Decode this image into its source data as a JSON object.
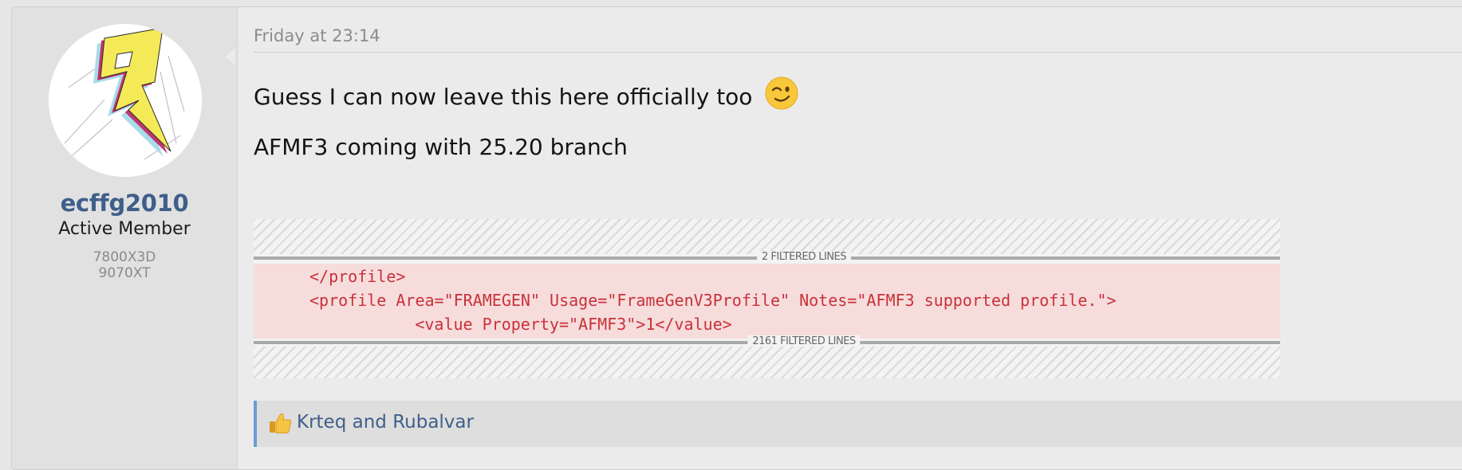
{
  "author": {
    "username": "ecffg2010",
    "title": "Active Member",
    "extras": [
      "7800X3D",
      "9070XT"
    ]
  },
  "post": {
    "date": "Friday at 23:14",
    "lines": [
      "Guess I can now leave this here officially too",
      "AFMF3 coming with 25.20 branch"
    ],
    "emoji": "winking-face-icon"
  },
  "diff": {
    "top_filter": "2 FILTERED LINES",
    "bottom_filter": "2161 FILTERED LINES",
    "code_lines": [
      "</profile>",
      "<profile Area=\"FRAMEGEN\" Usage=\"FrameGenV3Profile\" Notes=\"AFMF3 supported profile.\">",
      "        <value Property=\"AFMF3\">1</value>"
    ]
  },
  "reactions": {
    "icon": "thumbs-up-icon",
    "names": "Krteq and Rubalvar"
  },
  "colors": {
    "username": "#3e5f8a",
    "code_text": "#c8323a",
    "code_bg": "#f7dcdc",
    "reaction_accent": "#6d9cd6"
  }
}
